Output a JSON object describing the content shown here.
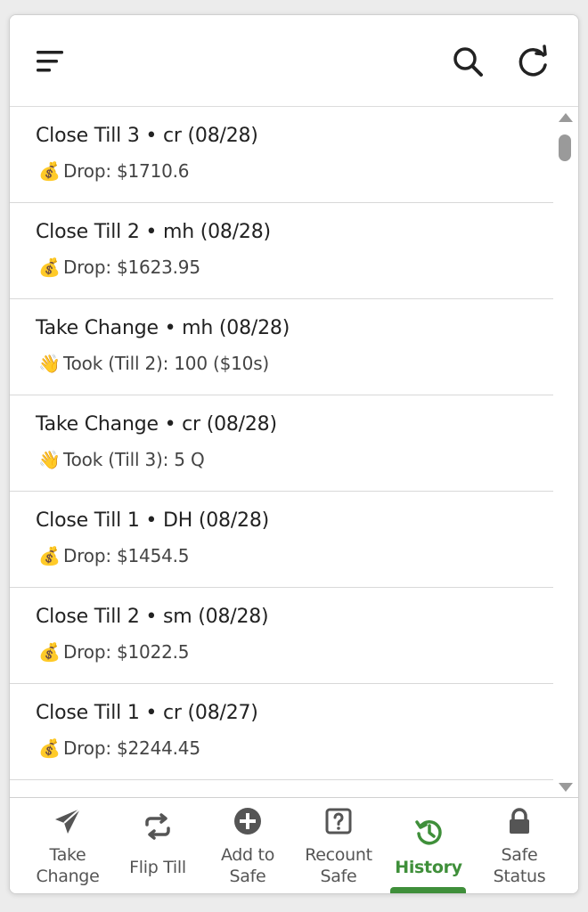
{
  "header": {
    "menu_icon": "hamburger-menu-icon",
    "search_icon": "search-icon",
    "refresh_icon": "refresh-icon"
  },
  "history": [
    {
      "title": "Close Till 3 • cr (08/28)",
      "icon": "money-bag-emoji",
      "emoji": "💰",
      "detail": "Drop: $1710.6"
    },
    {
      "title": "Close Till 2 • mh (08/28)",
      "icon": "money-bag-emoji",
      "emoji": "💰",
      "detail": "Drop: $1623.95"
    },
    {
      "title": "Take Change • mh (08/28)",
      "icon": "waving-hand-emoji",
      "emoji": "👋",
      "detail": "Took (Till 2): 100 ($10s)"
    },
    {
      "title": "Take Change • cr (08/28)",
      "icon": "waving-hand-emoji",
      "emoji": "👋",
      "detail": "Took (Till 3): 5 Q"
    },
    {
      "title": "Close Till 1 • DH (08/28)",
      "icon": "money-bag-emoji",
      "emoji": "💰",
      "detail": "Drop: $1454.5"
    },
    {
      "title": "Close Till 2 • sm (08/28)",
      "icon": "money-bag-emoji",
      "emoji": "💰",
      "detail": "Drop: $1022.5"
    },
    {
      "title": "Close Till 1 • cr (08/27)",
      "icon": "money-bag-emoji",
      "emoji": "💰",
      "detail": "Drop: $2244.45"
    }
  ],
  "nav": [
    {
      "line1": "Take",
      "line2": "Change",
      "icon": "paper-plane-icon"
    },
    {
      "line1": "Flip Till",
      "icon": "swap-arrows-icon"
    },
    {
      "line1": "Add to",
      "line2": "Safe",
      "icon": "plus-circle-icon"
    },
    {
      "line1": "Recount",
      "line2": "Safe",
      "icon": "question-box-icon"
    },
    {
      "line1": "History",
      "icon": "history-icon",
      "active": true
    },
    {
      "line1": "Safe",
      "line2": "Status",
      "icon": "lock-icon"
    }
  ],
  "colors": {
    "active": "#3f8f3a",
    "icon": "#555555",
    "text": "#212121"
  }
}
